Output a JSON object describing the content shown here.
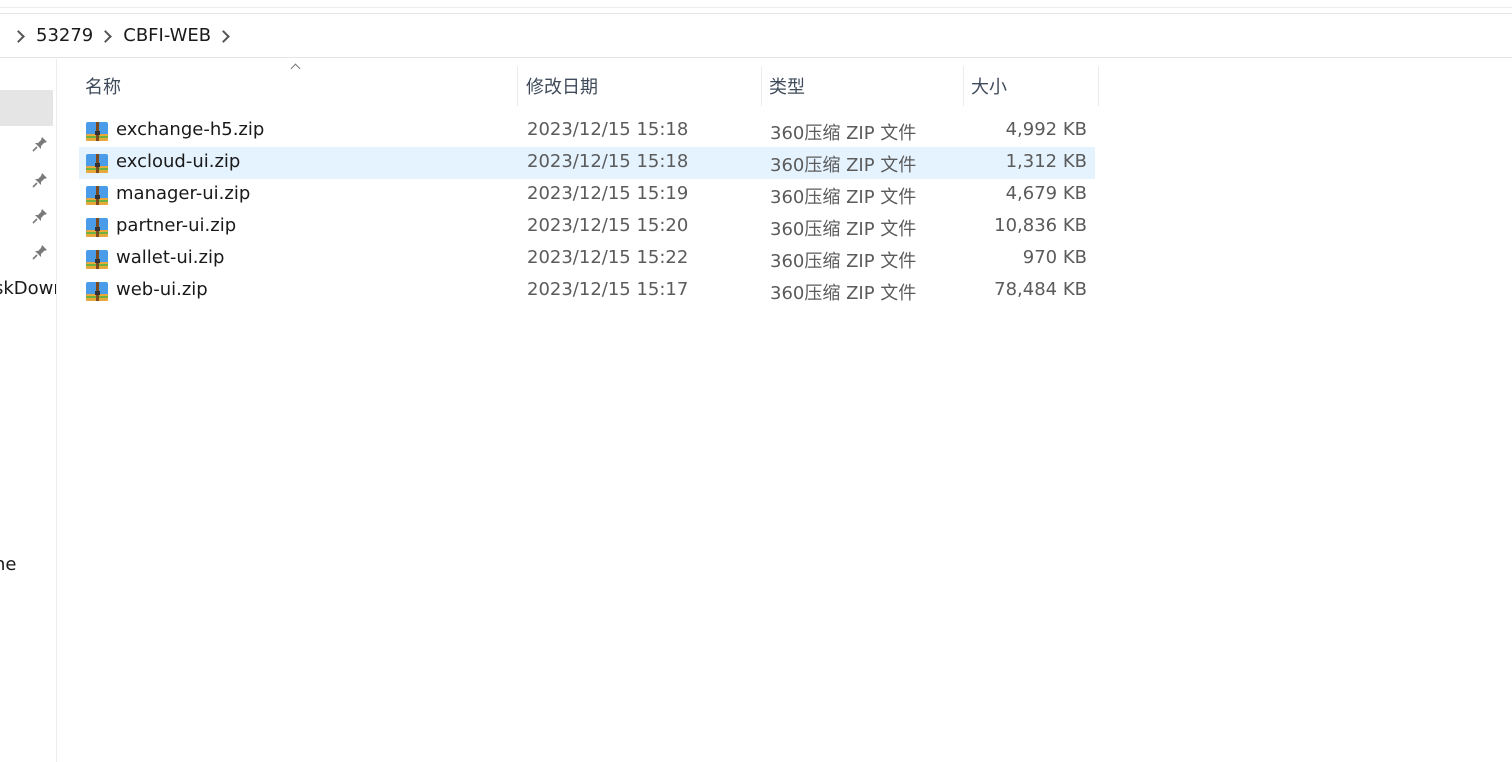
{
  "breadcrumb": {
    "items": [
      "53279",
      "CBFI-WEB"
    ]
  },
  "nav": {
    "partial_items": [
      "skDown",
      "ne"
    ],
    "pin_icon": "pin-icon"
  },
  "columns": {
    "name": "名称",
    "date": "修改日期",
    "type": "类型",
    "size": "大小"
  },
  "files": [
    {
      "name": "exchange-h5.zip",
      "date": "2023/12/15 15:18",
      "type": "360压缩 ZIP 文件",
      "size": "4,992 KB"
    },
    {
      "name": "excloud-ui.zip",
      "date": "2023/12/15 15:18",
      "type": "360压缩 ZIP 文件",
      "size": "1,312 KB"
    },
    {
      "name": "manager-ui.zip",
      "date": "2023/12/15 15:19",
      "type": "360压缩 ZIP 文件",
      "size": "4,679 KB"
    },
    {
      "name": "partner-ui.zip",
      "date": "2023/12/15 15:20",
      "type": "360压缩 ZIP 文件",
      "size": "10,836 KB"
    },
    {
      "name": "wallet-ui.zip",
      "date": "2023/12/15 15:22",
      "type": "360压缩 ZIP 文件",
      "size": "970 KB"
    },
    {
      "name": "web-ui.zip",
      "date": "2023/12/15 15:17",
      "type": "360压缩 ZIP 文件",
      "size": "78,484 KB"
    }
  ],
  "colors": {
    "hover_row": "#e5f3ff",
    "nav_selected": "#e5e5e5",
    "header_text": "#3f4b5a"
  }
}
